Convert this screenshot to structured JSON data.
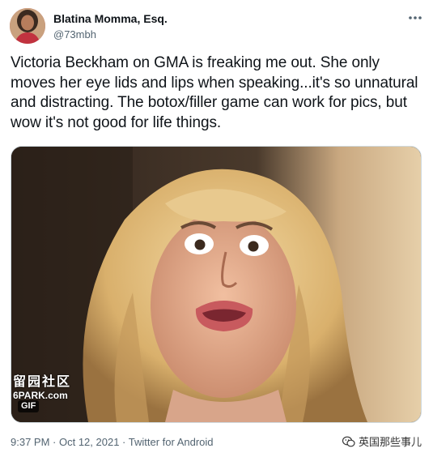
{
  "user": {
    "display_name": "Blatina Momma, Esq.",
    "handle": "@73mbh"
  },
  "tweet": {
    "text": "Victoria Beckham on GMA is freaking me out. She only moves her eye lids and lips when speaking...it's so unnatural and distracting.  The botox/filler game can work for pics, but wow it's not good for life things."
  },
  "media": {
    "badge": "GIF",
    "watermark_line1": "留园社区",
    "watermark_line2": "6PARK.com"
  },
  "meta": {
    "time": "9:37 PM",
    "separator": " · ",
    "date": "Oct 12, 2021",
    "separator2": " · ",
    "source": "Twitter for Android"
  },
  "wechat": {
    "label": "英国那些事儿"
  },
  "icons": {
    "more": "more-horizontal-icon",
    "wechat": "wechat-icon"
  },
  "colors": {
    "text": "#0f1419",
    "secondary": "#536471",
    "border": "#cfd9de"
  }
}
